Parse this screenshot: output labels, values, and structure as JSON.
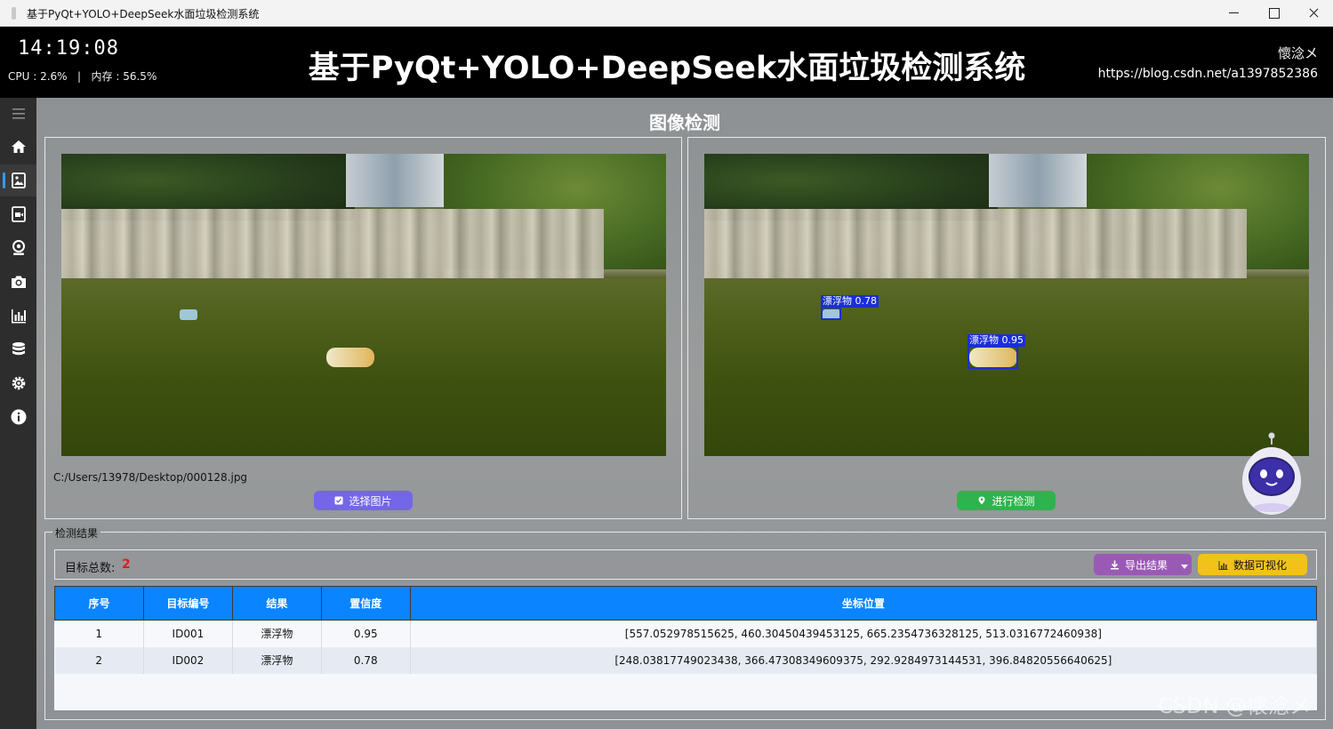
{
  "window": {
    "title": "基于PyQt+YOLO+DeepSeek水面垃圾检测系统"
  },
  "header": {
    "clock": "14:19:08",
    "cpu_label": "CPU",
    "cpu_value": "2.6%",
    "mem_label": "内存",
    "mem_value": "56.5%",
    "separator": "|",
    "title": "基于PyQt+YOLO+DeepSeek水面垃圾检测系统",
    "author": "懷淰メ",
    "blog": "https://blog.csdn.net/a1397852386"
  },
  "sidebar": {
    "items": [
      {
        "icon": "menu-icon"
      },
      {
        "icon": "home-icon"
      },
      {
        "icon": "image-icon",
        "active": true
      },
      {
        "icon": "video-icon"
      },
      {
        "icon": "webcam-icon"
      },
      {
        "icon": "camera-icon"
      },
      {
        "icon": "bar-chart-icon"
      },
      {
        "icon": "database-icon"
      },
      {
        "icon": "settings-icon"
      },
      {
        "icon": "info-icon"
      }
    ]
  },
  "main": {
    "page_title": "图像检测",
    "file_path": "C:/Users/13978/Desktop/000128.jpg",
    "select_button": "选择图片",
    "detect_button": "进行检测",
    "detections_overlay": [
      {
        "label": "漂浮物 0.78"
      },
      {
        "label": "漂浮物 0.95"
      }
    ]
  },
  "results": {
    "legend": "检测结果",
    "total_label": "目标总数:",
    "total_value": "2",
    "export_button": "导出结果",
    "visualize_button": "数据可视化",
    "columns": [
      "序号",
      "目标编号",
      "结果",
      "置信度",
      "坐标位置"
    ],
    "rows": [
      {
        "index": "1",
        "id": "ID001",
        "result": "漂浮物",
        "confidence": "0.95",
        "coords": "[557.052978515625, 460.30450439453125, 665.2354736328125, 513.0316772460938]"
      },
      {
        "index": "2",
        "id": "ID002",
        "result": "漂浮物",
        "confidence": "0.78",
        "coords": "[248.03817749023438, 366.47308349609375, 292.9284973144531, 396.84820556640625]"
      }
    ]
  },
  "watermark": "CSDN @懷淰メ",
  "colors": {
    "header_bg": "#000000",
    "table_header": "#0a84ff",
    "select_button": "#7366e8",
    "detect_button": "#2fb34e",
    "export_button": "#9b59b6",
    "visualize_button": "#f2c21a",
    "bbox": "#1a2ed8",
    "count": "#e01c1c"
  }
}
